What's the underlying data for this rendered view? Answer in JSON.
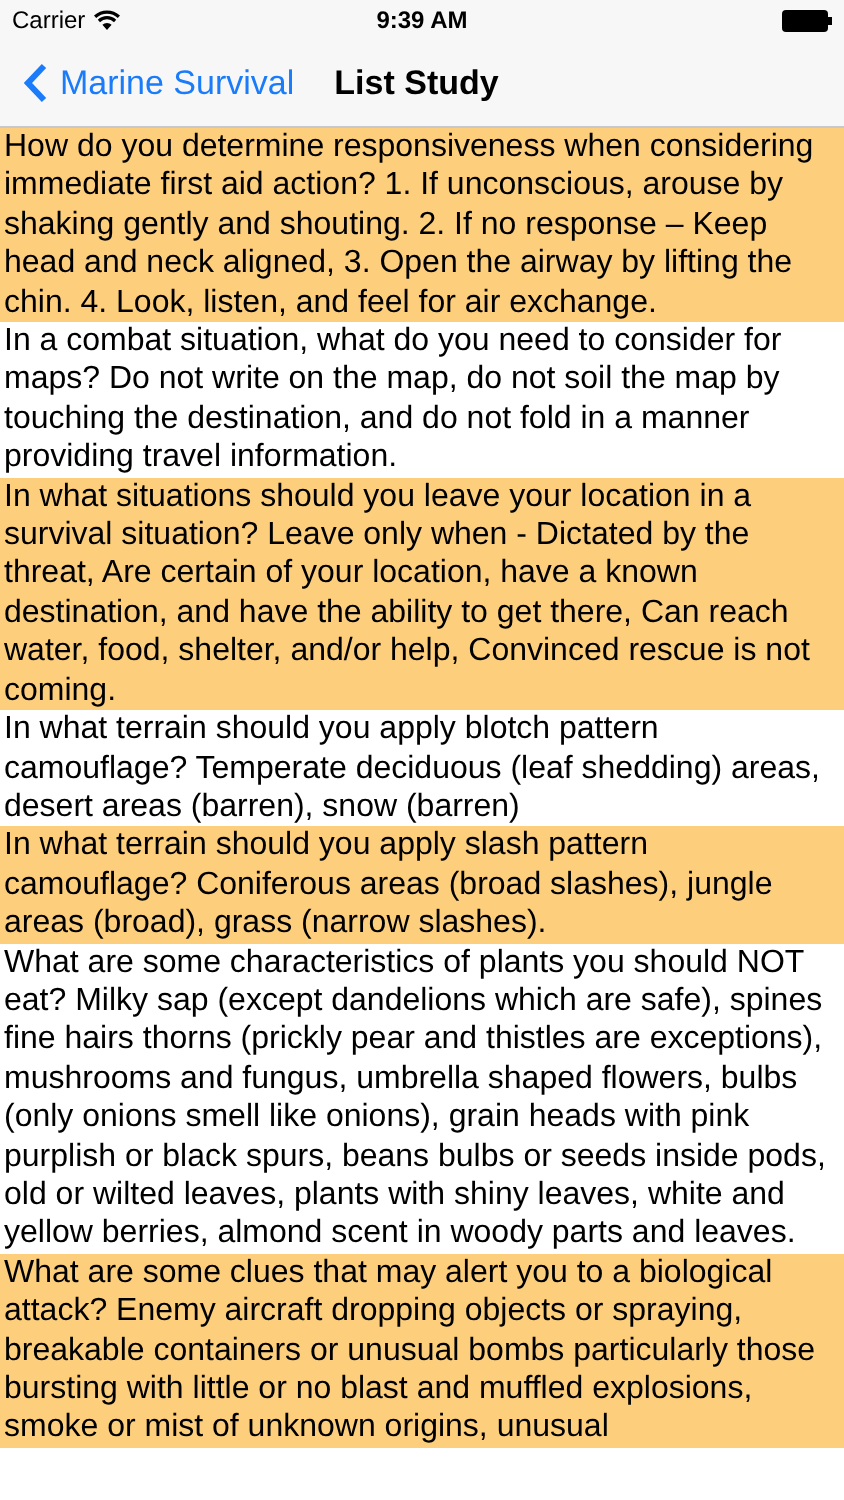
{
  "status_bar": {
    "carrier": "Carrier",
    "time": "9:39 AM"
  },
  "nav_bar": {
    "back_label": "Marine Survival",
    "title": "List Study"
  },
  "items": [
    {
      "text": "How do you determine responsiveness when considering immediate first aid action? 1. If unconscious, arouse by shaking gently and shouting. 2. If no response – Keep head and neck aligned, 3. Open the airway by lifting the chin. 4. Look, listen, and feel for air exchange.",
      "highlighted": true
    },
    {
      "text": "In a combat situation, what do you need to consider for maps? Do not write on the map, do not soil the map by touching the destination, and do not fold in a manner providing travel information.",
      "highlighted": false
    },
    {
      "text": "In what situations should you leave your location in a survival situation? Leave only when - Dictated by the threat, Are certain of your location, have a known destination, and have the ability to get there, Can reach water, food, shelter, and/or help, Convinced rescue is not coming.",
      "highlighted": true
    },
    {
      "text": "In what terrain should you apply blotch pattern camouflage? Temperate deciduous (leaf shedding) areas, desert areas (barren), snow (barren)",
      "highlighted": false
    },
    {
      "text": "In what terrain should you apply slash pattern camouflage? Coniferous areas (broad slashes), jungle areas (broad), grass (narrow slashes).",
      "highlighted": true
    },
    {
      "text": "What are some characteristics of plants you should NOT eat? Milky sap (except dandelions which are safe), spines fine hairs thorns (prickly pear and thistles are exceptions), mushrooms and fungus, umbrella shaped flowers, bulbs (only onions smell like onions), grain heads with pink purplish or black spurs, beans bulbs or seeds inside pods, old or wilted leaves, plants with shiny leaves, white and yellow berries, almond scent in woody parts and leaves.",
      "highlighted": false
    },
    {
      "text": "What are some clues that may alert you to a biological attack? Enemy aircraft dropping objects or spraying, breakable containers or unusual bombs particularly those bursting with little or no blast and muffled explosions, smoke or mist of unknown origins, unusual",
      "highlighted": true
    }
  ]
}
